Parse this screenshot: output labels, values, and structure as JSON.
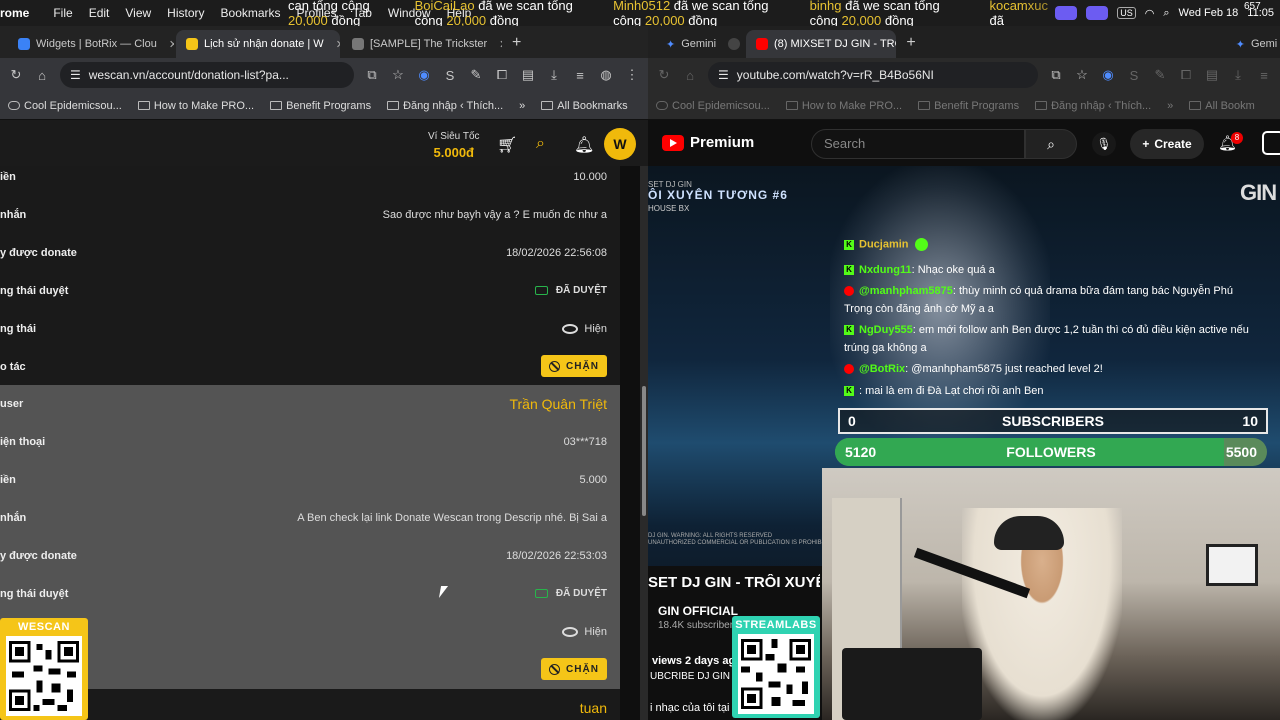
{
  "menubar": {
    "app": "rome",
    "menus": [
      "File",
      "Edit",
      "View",
      "History",
      "Bookmarks",
      "Profiles",
      "Tab",
      "Window",
      "Help"
    ],
    "ticker": [
      {
        "name": "",
        "text": "can tổng cộng ",
        "amount": "20,000",
        "tail": " đồng"
      },
      {
        "name": "BoiCaiLao",
        "text": " đã we scan tổng cộng ",
        "amount": "20,000",
        "tail": " đồng"
      },
      {
        "name": "Minh0512",
        "text": " đã we scan tổng cộng ",
        "amount": "20,000",
        "tail": " đồng"
      },
      {
        "name": "binhg",
        "text": " đã we scan tổng cộng ",
        "amount": "20,000",
        "tail": " đồng"
      },
      {
        "name": "kocamxuc",
        "text": " đã",
        "amount": "",
        "tail": ""
      }
    ],
    "status": {
      "lang": "US",
      "date": "Wed Feb 18",
      "time": "11:05",
      "counter": "657"
    }
  },
  "left_browser": {
    "tabs": [
      {
        "title": "Widgets | BotRix — Clou",
        "active": false
      },
      {
        "title": "Lịch sử nhận donate | W",
        "active": true
      },
      {
        "title": "[SAMPLE] The Trickster",
        "active": false
      }
    ],
    "url": "wescan.vn/account/donation-list?pa...",
    "bookmarks": [
      "Cool Epidemicsou...",
      "How to Make PRO...",
      "Benefit Programs",
      "Đăng nhập ‹ Thích..."
    ],
    "all_bookmarks": "All Bookmarks"
  },
  "right_browser": {
    "tabs": [
      {
        "title": "Gemini",
        "active": false
      },
      {
        "title": "(8) MIXSET DJ GIN - TRÔ",
        "active": true
      }
    ],
    "partial_tab": "Gemi",
    "url": "youtube.com/watch?v=rR_B4Bo56NI",
    "bookmarks": [
      "Cool Epidemicsou...",
      "How to Make PRO...",
      "Benefit Programs",
      "Đăng nhập ‹ Thích..."
    ],
    "all_bookmarks": "All Bookm"
  },
  "wescan": {
    "wallet_label": "Ví Siêu Tốc",
    "wallet_amount": "5.000đ",
    "avatar_letter": "W",
    "rows": [
      {
        "k": "iền",
        "v": "10.000"
      },
      {
        "k": "nhắn",
        "v": "Sao được như bạyh vậy a ? E muốn đc như a"
      },
      {
        "k": "y được donate",
        "v": "18/02/2026 22:56:08"
      },
      {
        "k": "ng thái duyệt",
        "v": "ĐÃ DUYỆT"
      },
      {
        "k": "ng thái",
        "v": "Hiện"
      },
      {
        "k": "o tác",
        "v": "CHẶN"
      },
      {
        "k": "user",
        "v": "Trần Quân Triệt"
      },
      {
        "k": "iện thoại",
        "v": "03***718"
      },
      {
        "k": "iền",
        "v": "5.000"
      },
      {
        "k": "nhắn",
        "v": "A Ben check lại link Donate Wescan trong Descrip nhé. Bị Sai a"
      },
      {
        "k": "y được donate",
        "v": "18/02/2026 22:53:03"
      },
      {
        "k": "ng thái duyệt",
        "v": "ĐÃ DUYỆT"
      },
      {
        "k": "",
        "v": "Hiện"
      },
      {
        "k": "",
        "v": "CHẶN"
      },
      {
        "k": "",
        "v": "tuan"
      }
    ],
    "qr_label": "WESCAN"
  },
  "youtube": {
    "brand": "Premium",
    "search_placeholder": "Search",
    "create_label": "Create",
    "notif_count": "8",
    "banner_small": "SET DJ GIN",
    "banner_title": "ÔI XUYÊN TƯƠNG #6",
    "banner_sub": "HOUSE BX",
    "logo": "GIN",
    "legal": [
      "DJ GIN. WARNING: ALL RIGHTS RESERVED",
      "UNAUTHORIZED COMMERCIAL OR PUBLICATION IS PROHIBITED"
    ],
    "chat": [
      {
        "platform": "kick",
        "name": "Ducjamin",
        "color": "#e7c232",
        "msg": ""
      },
      {
        "platform": "kick",
        "name": "Nxdung11",
        "color": "#53fc18",
        "msg": ": Nhạc oke quá a"
      },
      {
        "platform": "youtube",
        "name": "@manhpham5875",
        "color": "#53fc18",
        "msg": ": thùy minh có quả drama bữa đám tang bác Nguyễn Phú"
      },
      {
        "platform": "",
        "name": "",
        "color": "#ffffff",
        "msg": "Trọng còn đăng ảnh cờ Mỹ a a"
      },
      {
        "platform": "kick",
        "name": "NgDuy555",
        "color": "#53fc18",
        "msg": ": em mới follow anh Ben được 1,2 tuần thì có đủ điều kiện active nếu"
      },
      {
        "platform": "",
        "name": "",
        "color": "#ffffff",
        "msg": "trúng ga không a"
      },
      {
        "platform": "youtube",
        "name": "@BotRix",
        "color": "#53fc18",
        "msg": ": @manhpham5875 just reached level 2!"
      },
      {
        "platform": "kick",
        "name": "",
        "color": "#53fc18",
        "msg": ": mai là em đi Đà Lạt chơi rồi anh Ben"
      }
    ],
    "subscribers": {
      "label": "SUBSCRIBERS",
      "current": "0",
      "goal": "10",
      "progress": 0
    },
    "followers": {
      "label": "FOLLOWERS",
      "current": "5120",
      "goal": "5500",
      "progress": 0.9
    },
    "video_title": "SET DJ GIN - TRÔI XUYÊ",
    "channel": "GIN OFFICIAL",
    "subs": "18.4K subscriber",
    "views": "views  2 days ag",
    "desc1": "UBCRIBE DJ GIN",
    "desc2": "i nhạc của tôi tại",
    "streamlabs_label": "STREAMLABS"
  }
}
